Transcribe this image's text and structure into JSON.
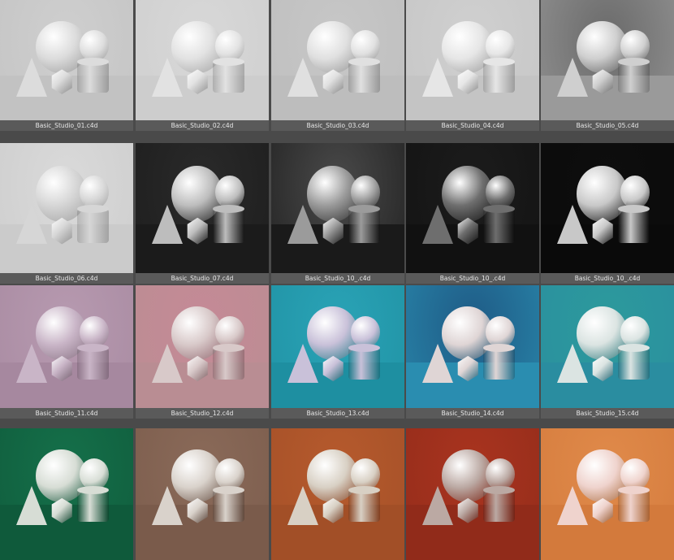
{
  "thumbnails": [
    {
      "label": "Basic_Studio_01.c4d",
      "bg": "#cfcfcf",
      "floor": "#c2c2c2",
      "obj": "#dcdcdc"
    },
    {
      "label": "Basic_Studio_02.c4d",
      "bg": "#d8d8d8",
      "floor": "#cdcdcd",
      "obj": "#e2e2e2"
    },
    {
      "label": "Basic_Studio_03.c4d",
      "bg": "#c7c7c7",
      "floor": "#bdbdbd",
      "obj": "#e0e0e0"
    },
    {
      "label": "Basic_Studio_04.c4d",
      "bg": "#d0d0d0",
      "floor": "#c4c4c4",
      "obj": "#e6e6e6"
    },
    {
      "label": "Basic_Studio_05.c4d",
      "bg": "#6a6a6a",
      "floor": "#9a9a9a",
      "obj": "#cfcfcf"
    },
    {
      "label": "Basic_Studio_06.c4d",
      "bg": "#dadada",
      "floor": "#cbcbcb",
      "obj": "#d6d6d6"
    },
    {
      "label": "Basic_Studio_07.c4d",
      "bg": "#2a2a2a",
      "floor": "#1b1b1b",
      "obj": "#bdbdbd"
    },
    {
      "label": "Basic_Studio_10_.c4d",
      "bg": "#4a4a4a",
      "floor": "#1a1a1a",
      "obj": "#9b9b9b"
    },
    {
      "label": "Basic_Studio_10_.c4d",
      "bg": "#1c1c1c",
      "floor": "#111111",
      "obj": "#6e6e6e"
    },
    {
      "label": "Basic_Studio_10_.c4d",
      "bg": "#0e0e0e",
      "floor": "#0a0a0a",
      "obj": "#c8c8c8"
    },
    {
      "label": "Basic_Studio_11.c4d",
      "bg": "#b79ab0",
      "floor": "#a6889f",
      "obj": "#c9b5c7"
    },
    {
      "label": "Basic_Studio_12.c4d",
      "bg": "#c58a96",
      "floor": "#b98d93",
      "obj": "#d8c9c9"
    },
    {
      "label": "Basic_Studio_13.c4d",
      "bg": "#2aa3b6",
      "floor": "#1e8fa1",
      "obj": "#c9c1d9"
    },
    {
      "label": "Basic_Studio_14.c4d",
      "bg": "#1f5b86",
      "floor": "#2a8db0",
      "obj": "#dfd5d5"
    },
    {
      "label": "Basic_Studio_15.c4d",
      "bg": "#2c9a9c",
      "floor": "#2a8da0",
      "obj": "#dbe4e2"
    },
    {
      "label": "",
      "bg": "#15704a",
      "floor": "#0f5a3b",
      "obj": "#d7ddd5"
    },
    {
      "label": "",
      "bg": "#8a6a59",
      "floor": "#7a5b4b",
      "obj": "#d9d2cb"
    },
    {
      "label": "",
      "bg": "#b65a2d",
      "floor": "#a24f27",
      "obj": "#d8d0c4"
    },
    {
      "label": "",
      "bg": "#a9341f",
      "floor": "#912b1a",
      "obj": "#bba9a3"
    },
    {
      "label": "",
      "bg": "#e08a4a",
      "floor": "#d37a3c",
      "obj": "#efd3cd"
    }
  ]
}
